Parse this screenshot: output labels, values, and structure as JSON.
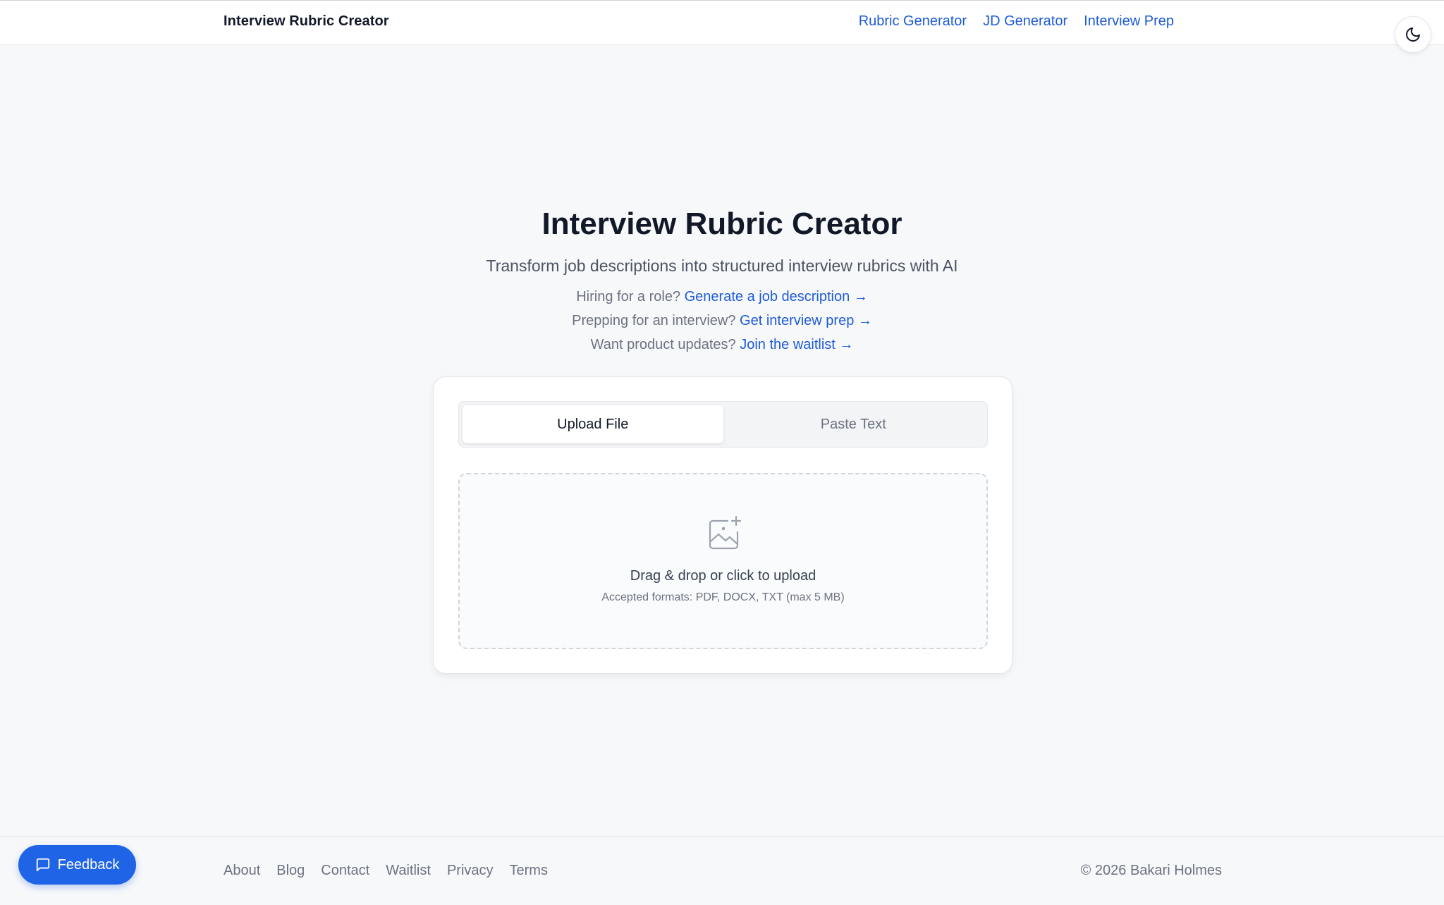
{
  "header": {
    "brand": "Interview Rubric Creator",
    "nav": [
      {
        "label": "Rubric Generator"
      },
      {
        "label": "JD Generator"
      },
      {
        "label": "Interview Prep"
      }
    ],
    "theme_toggle_icon": "moon-icon"
  },
  "hero": {
    "title": "Interview Rubric Creator",
    "subtitle": "Transform job descriptions into structured interview rubrics with AI",
    "ctas": [
      {
        "prompt": "Hiring for a role?",
        "link": "Generate a job description →"
      },
      {
        "prompt": "Prepping for an interview?",
        "link": "Get interview prep →"
      },
      {
        "prompt": "Want product updates?",
        "link": "Join the waitlist →"
      }
    ]
  },
  "card": {
    "tabs": [
      {
        "label": "Upload File",
        "active": true
      },
      {
        "label": "Paste Text",
        "active": false
      }
    ],
    "dropzone": {
      "icon": "image-upload-icon",
      "main_text": "Drag & drop or click to upload",
      "sub_text": "Accepted formats: PDF, DOCX, TXT (max 5 MB)"
    }
  },
  "footer": {
    "links": [
      {
        "label": "About"
      },
      {
        "label": "Blog"
      },
      {
        "label": "Contact"
      },
      {
        "label": "Waitlist"
      },
      {
        "label": "Privacy"
      },
      {
        "label": "Terms"
      }
    ],
    "copyright": "© 2026 Bakari Holmes"
  },
  "feedback": {
    "label": "Feedback",
    "icon": "chat-bubble-icon"
  },
  "colors": {
    "accent": "#1d5bd6",
    "feedback_button": "#1f63e6",
    "background": "#f7f8fa"
  }
}
